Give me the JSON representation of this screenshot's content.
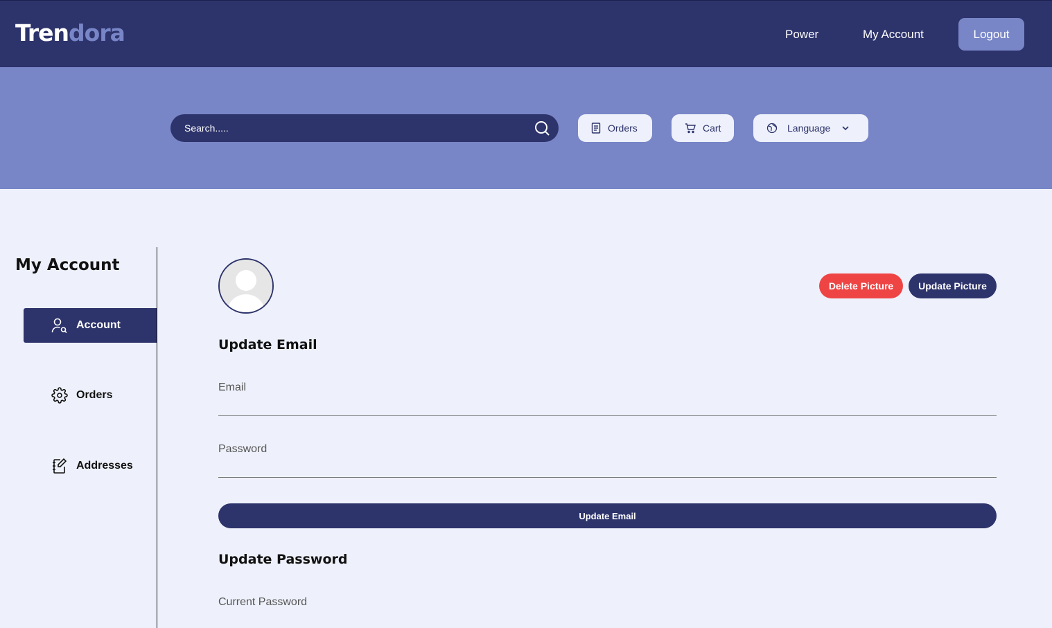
{
  "brand": {
    "part1": "Tren",
    "part2": "dora"
  },
  "nav": {
    "power": "Power",
    "my_account": "My Account",
    "logout": "Logout"
  },
  "search": {
    "placeholder": "Search....."
  },
  "toolbar": {
    "orders": "Orders",
    "cart": "Cart",
    "language": "Language"
  },
  "sidebar": {
    "title": "My Account",
    "items": [
      {
        "label": "Account",
        "icon": "user-search-icon",
        "active": true
      },
      {
        "label": "Orders",
        "icon": "gear-icon",
        "active": false
      },
      {
        "label": "Addresses",
        "icon": "notebook-edit-icon",
        "active": false
      }
    ]
  },
  "profile": {
    "delete_picture": "Delete Picture",
    "update_picture": "Update Picture"
  },
  "update_email": {
    "title": "Update Email",
    "email_placeholder": "Email",
    "password_placeholder": "Password",
    "submit": "Update Email"
  },
  "update_password": {
    "title": "Update Password",
    "current_password_placeholder": "Current Password"
  },
  "colors": {
    "primary": "#2d336b",
    "accent": "#7886c7",
    "background": "#eef1fb",
    "danger": "#ef4444"
  }
}
